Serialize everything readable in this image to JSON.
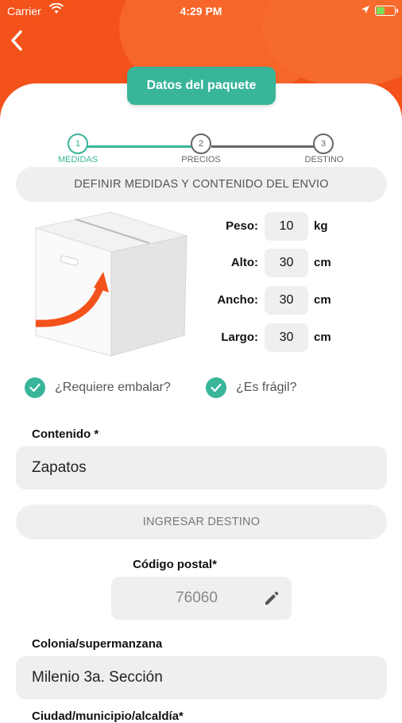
{
  "status_bar": {
    "carrier": "Carrier",
    "time": "4:29 PM"
  },
  "header": {
    "title": "Datos del paquete"
  },
  "steps": [
    {
      "number": "1",
      "label": "MEDIDAS",
      "active": true
    },
    {
      "number": "2",
      "label": "PRECIOS",
      "active": false
    },
    {
      "number": "3",
      "label": "DESTINO",
      "active": false
    }
  ],
  "section_measures": "DEFINIR MEDIDAS Y CONTENIDO DEL ENVIO",
  "measures": {
    "weight": {
      "label": "Peso:",
      "value": "10",
      "unit": "kg"
    },
    "height": {
      "label": "Alto:",
      "value": "30",
      "unit": "cm"
    },
    "width": {
      "label": "Ancho:",
      "value": "30",
      "unit": "cm"
    },
    "length": {
      "label": "Largo:",
      "value": "30",
      "unit": "cm"
    }
  },
  "options": {
    "packing": {
      "label": "¿Requiere embalar?",
      "checked": true
    },
    "fragile": {
      "label": "¿Es frágil?",
      "checked": true
    }
  },
  "content": {
    "label": "Contenido *",
    "value": "Zapatos"
  },
  "section_destination": "INGRESAR DESTINO",
  "postal_code": {
    "label": "Código postal*",
    "value": "76060"
  },
  "colonia": {
    "label": "Colonia/supermanzana",
    "value": "Milenio 3a. Sección"
  },
  "next_label": "Ciudad/municipio/alcaldía*",
  "colors": {
    "brand_orange": "#f4521b",
    "accent_teal": "#39b59a",
    "field_bg": "#efefef"
  }
}
